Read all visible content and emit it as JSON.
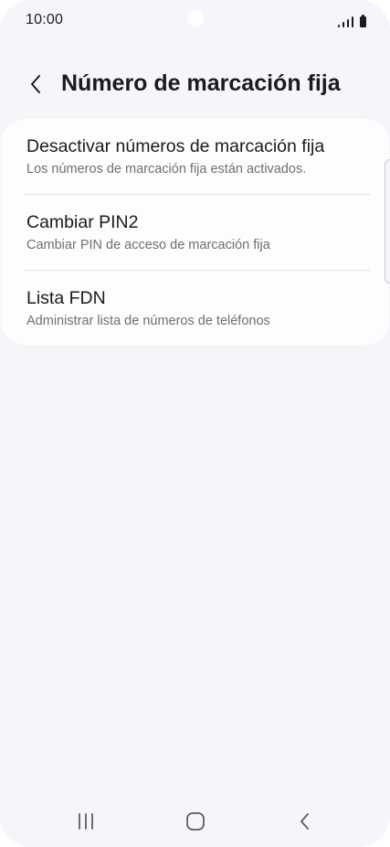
{
  "status_bar": {
    "time": "10:00"
  },
  "header": {
    "title": "Número de marcación fija",
    "back_icon": "chevron-left-icon"
  },
  "menu": {
    "items": [
      {
        "title": "Desactivar números de marcación fija",
        "subtitle": "Los números de marcación fija están activados."
      },
      {
        "title": "Cambiar PIN2",
        "subtitle": "Cambiar PIN de acceso de marcación fija"
      },
      {
        "title": "Lista FDN",
        "subtitle": "Administrar lista de números de teléfonos"
      }
    ]
  },
  "navigation": {
    "recents_icon": "recent-apps-icon",
    "home_icon": "home-icon",
    "back_icon": "back-icon"
  },
  "colors": {
    "background": "#f6f5fa",
    "card": "#fdfdfe",
    "primary_text": "#1b1b1d",
    "secondary_text": "#6f6f74"
  }
}
